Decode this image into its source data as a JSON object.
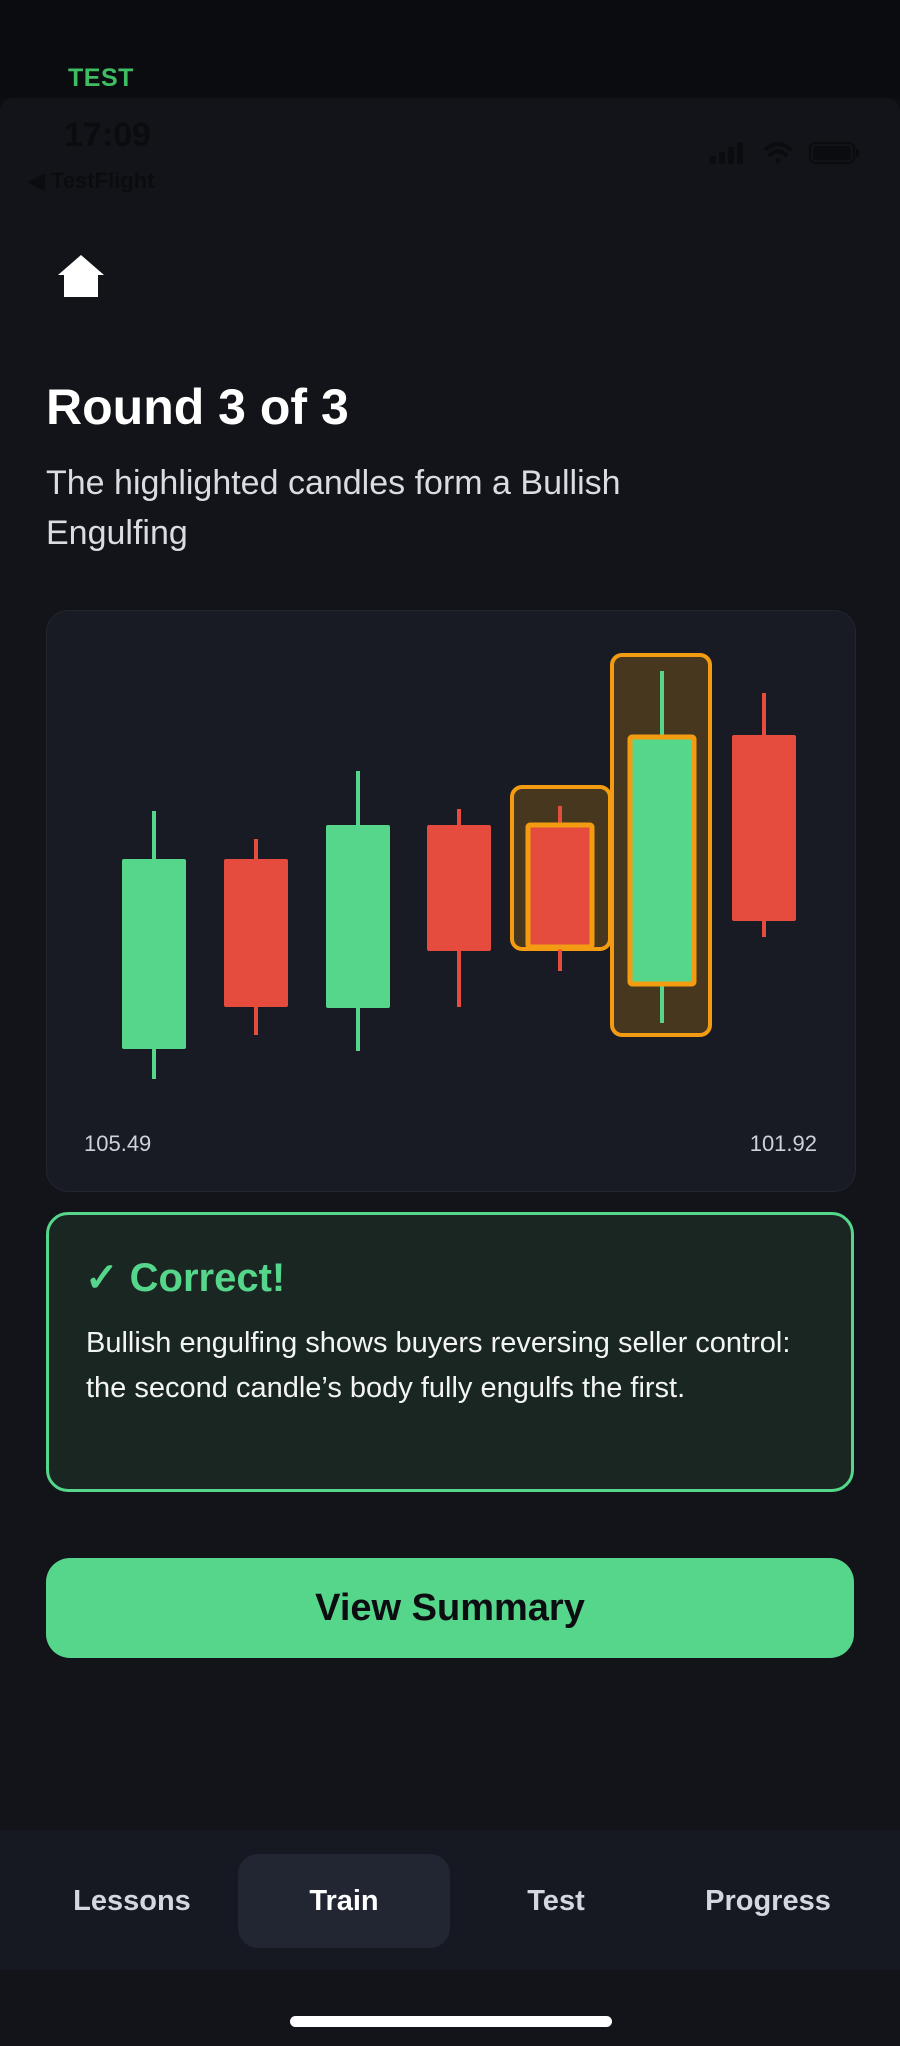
{
  "test_tag": "TEST",
  "status_bar": {
    "time": "17:09",
    "back_label": "◀ TestFlight"
  },
  "header": {
    "round_title": "Round 3 of 3",
    "prompt": "The highlighted candles form a Bullish Engulfing"
  },
  "chart": {
    "price_left": "105.49",
    "price_right": "101.92",
    "colors": {
      "bull": "#56d68b",
      "bear": "#e64c3e",
      "highlight": "#f39c12"
    },
    "candles": [
      {
        "dir": "bull",
        "highlighted": false
      },
      {
        "dir": "bear",
        "highlighted": false
      },
      {
        "dir": "bull",
        "highlighted": false
      },
      {
        "dir": "bear",
        "highlighted": false
      },
      {
        "dir": "bear",
        "highlighted": true
      },
      {
        "dir": "bull",
        "highlighted": true
      },
      {
        "dir": "bear",
        "highlighted": false
      }
    ]
  },
  "feedback": {
    "title": "✓ Correct!",
    "text": "Bullish engulfing shows buyers reversing seller control: the second candle’s body fully engulfs the first."
  },
  "cta": {
    "label": "View Summary"
  },
  "tabs": [
    {
      "label": "Lessons",
      "active": false
    },
    {
      "label": "Train",
      "active": true
    },
    {
      "label": "Test",
      "active": false
    },
    {
      "label": "Progress",
      "active": false
    }
  ]
}
